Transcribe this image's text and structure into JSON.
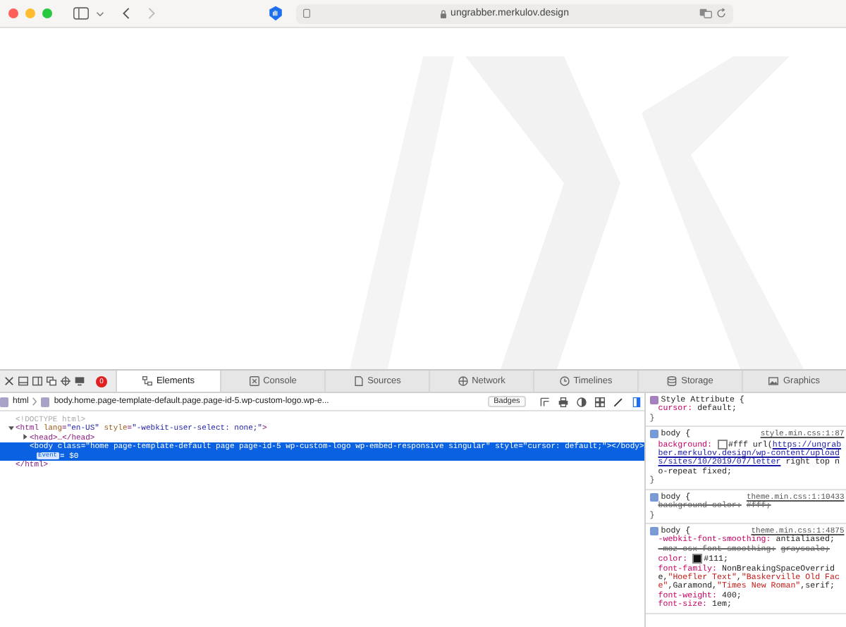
{
  "browser": {
    "url": "ungrabber.merkulov.design"
  },
  "devtools": {
    "error_count": "0",
    "tabs": [
      {
        "label": "Elements",
        "selected": true
      },
      {
        "label": "Console",
        "selected": false
      },
      {
        "label": "Sources",
        "selected": false
      },
      {
        "label": "Network",
        "selected": false
      },
      {
        "label": "Timelines",
        "selected": false
      },
      {
        "label": "Storage",
        "selected": false
      },
      {
        "label": "Graphics",
        "selected": false
      }
    ],
    "breadcrumb": [
      {
        "label": "html"
      },
      {
        "label": "body.home.page-template-default.page.page-id-5.wp-custom-logo.wp-e..."
      }
    ],
    "badges_button": "Badges",
    "dom_tree": [
      {
        "kind": "doctype",
        "selected": false,
        "segments": [
          {
            "text": "<!DOCTYPE html>",
            "kind": "plain"
          }
        ]
      },
      {
        "kind": "element",
        "expanded": true,
        "selected": false,
        "segments": [
          {
            "text": "<html ",
            "kind": "tag"
          },
          {
            "text": "lang",
            "kind": "attr"
          },
          {
            "text": "=",
            "kind": "tag"
          },
          {
            "text": "\"en-US\"",
            "kind": "value"
          },
          {
            "text": " style",
            "kind": "attr"
          },
          {
            "text": "=",
            "kind": "tag"
          },
          {
            "text": "\"-webkit-user-select: none;\"",
            "kind": "value"
          },
          {
            "text": ">",
            "kind": "tag"
          }
        ],
        "children": [
          {
            "kind": "element",
            "expanded": false,
            "selected": false,
            "segments": [
              {
                "text": "<head>…</head>",
                "kind": "tag"
              }
            ]
          },
          {
            "kind": "leaf",
            "selected": true,
            "segments": [
              {
                "text": "<body ",
                "kind": "tag"
              },
              {
                "text": "class",
                "kind": "attr"
              },
              {
                "text": "=",
                "kind": "tag"
              },
              {
                "text": "\"home page-template-default page page-id-5 wp-custom-logo wp-embed-responsive singular\"",
                "kind": "value"
              },
              {
                "text": " style",
                "kind": "attr"
              },
              {
                "text": "=",
                "kind": "tag"
              },
              {
                "text": "\"cursor: default;\"",
                "kind": "value"
              },
              {
                "text": "></body>",
                "kind": "tag"
              }
            ],
            "badge": "Event",
            "note": "= $0"
          }
        ],
        "end": "</html>"
      }
    ],
    "rules": [
      {
        "kind": "attribute",
        "selector": "Style Attribute {",
        "declarations": [
          {
            "prop": "cursor:",
            "value": [
              {
                "text": "default;",
                "kind": "plain"
              }
            ],
            "overridden": false
          }
        ],
        "close": "}"
      },
      {
        "kind": "rule",
        "selector": "body {",
        "source": "style.min.css:1:87",
        "declarations": [
          {
            "prop": "background:",
            "value": [
              {
                "text": "#fff ",
                "kind": "color"
              },
              {
                "text": "url(",
                "kind": "plain"
              },
              {
                "text": "https://ungrabber.merkulov.design/wp-content/uploads/sites/10/2019/07/letter",
                "kind": "link"
              },
              {
                "text": " right top no-repeat fixed;",
                "kind": "plain"
              }
            ],
            "overridden": false
          }
        ],
        "close": "}"
      },
      {
        "kind": "rule",
        "selector": "body {",
        "source": "theme.min.css:1:10433",
        "declarations": [
          {
            "prop": "background-color:",
            "value": [
              {
                "text": "#fff;",
                "kind": "plain"
              }
            ],
            "overridden": true
          }
        ],
        "close": "}"
      },
      {
        "kind": "rule",
        "selector": "body {",
        "source": "theme.min.css:1:4875",
        "declarations": [
          {
            "prop": "-webkit-font-smoothing:",
            "value": [
              {
                "text": "antialiased;",
                "kind": "plain"
              }
            ],
            "overridden": false
          },
          {
            "prop": "-moz-osx-font-smoothing:",
            "value": [
              {
                "text": "grayscale;",
                "kind": "plain"
              }
            ],
            "overridden": true
          },
          {
            "prop": "color:",
            "value": [
              {
                "text": "#111;",
                "kind": "color"
              }
            ],
            "overridden": false
          },
          {
            "prop": "font-family:",
            "value": [
              {
                "text": "NonBreakingSpaceOverride,",
                "kind": "plain"
              },
              {
                "text": "\"Hoefler Text\"",
                "kind": "string"
              },
              {
                "text": ",",
                "kind": "plain"
              },
              {
                "text": "\"Baskerville Old Face\"",
                "kind": "string"
              },
              {
                "text": ",Garamond,",
                "kind": "plain"
              },
              {
                "text": "\"Times New Roman\"",
                "kind": "string"
              },
              {
                "text": ",serif;",
                "kind": "plain"
              }
            ],
            "overridden": false
          },
          {
            "prop": "font-weight:",
            "value": [
              {
                "text": "400;",
                "kind": "plain"
              }
            ],
            "overridden": false
          },
          {
            "prop": "font-size:",
            "value": [
              {
                "text": "1em;",
                "kind": "plain"
              }
            ],
            "overridden": false
          }
        ]
      }
    ]
  }
}
